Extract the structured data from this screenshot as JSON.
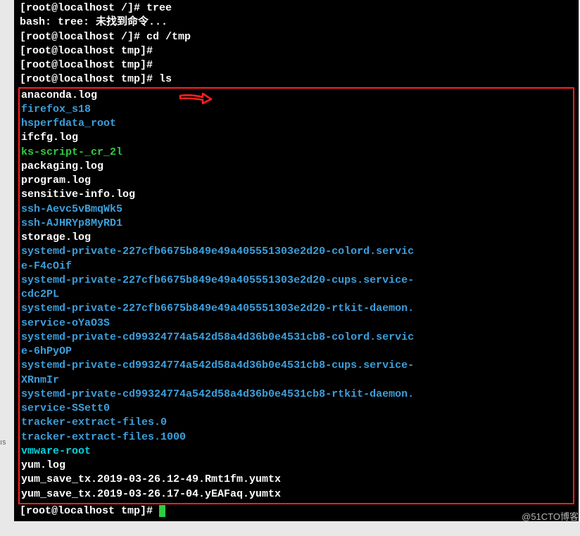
{
  "lines": [
    {
      "parts": [
        {
          "cls": "white",
          "t": "[root@localhost /]# tree"
        }
      ]
    },
    {
      "parts": [
        {
          "cls": "white",
          "t": "bash: tree: 未找到命令..."
        }
      ]
    },
    {
      "parts": [
        {
          "cls": "white",
          "t": "[root@localhost /]# cd /tmp"
        }
      ]
    },
    {
      "parts": [
        {
          "cls": "white",
          "t": "[root@localhost tmp]#"
        }
      ]
    },
    {
      "parts": [
        {
          "cls": "white",
          "t": "[root@localhost tmp]#"
        }
      ]
    },
    {
      "parts": [
        {
          "cls": "white",
          "t": "[root@localhost tmp]# ls"
        }
      ]
    }
  ],
  "box_lines": [
    {
      "parts": [
        {
          "cls": "white",
          "t": "anaconda.log"
        }
      ]
    },
    {
      "parts": [
        {
          "cls": "blue",
          "t": "firefox_s18"
        }
      ]
    },
    {
      "parts": [
        {
          "cls": "blue",
          "t": "hsperfdata_root"
        }
      ]
    },
    {
      "parts": [
        {
          "cls": "white",
          "t": "ifcfg.log"
        }
      ]
    },
    {
      "parts": [
        {
          "cls": "green",
          "t": "ks-script-_cr_2l"
        }
      ]
    },
    {
      "parts": [
        {
          "cls": "white",
          "t": "packaging.log"
        }
      ]
    },
    {
      "parts": [
        {
          "cls": "white",
          "t": "program.log"
        }
      ]
    },
    {
      "parts": [
        {
          "cls": "white",
          "t": "sensitive-info.log"
        }
      ]
    },
    {
      "parts": [
        {
          "cls": "blue",
          "t": "ssh-Aevc5vBmqWk5"
        }
      ]
    },
    {
      "parts": [
        {
          "cls": "blue",
          "t": "ssh-AJHRYp8MyRD1"
        }
      ]
    },
    {
      "parts": [
        {
          "cls": "white",
          "t": "storage.log"
        }
      ]
    },
    {
      "parts": [
        {
          "cls": "blue",
          "t": "systemd-private-227cfb6675b849e49a405551303e2d20-colord.servic"
        }
      ]
    },
    {
      "parts": [
        {
          "cls": "blue",
          "t": "e-F4cOif"
        }
      ]
    },
    {
      "parts": [
        {
          "cls": "blue",
          "t": "systemd-private-227cfb6675b849e49a405551303e2d20-cups.service-"
        }
      ]
    },
    {
      "parts": [
        {
          "cls": "blue",
          "t": "cdc2PL"
        }
      ]
    },
    {
      "parts": [
        {
          "cls": "blue",
          "t": "systemd-private-227cfb6675b849e49a405551303e2d20-rtkit-daemon."
        }
      ]
    },
    {
      "parts": [
        {
          "cls": "blue",
          "t": "service-oYaO3S"
        }
      ]
    },
    {
      "parts": [
        {
          "cls": "blue",
          "t": "systemd-private-cd99324774a542d58a4d36b0e4531cb8-colord.servic"
        }
      ]
    },
    {
      "parts": [
        {
          "cls": "blue",
          "t": "e-6hPyOP"
        }
      ]
    },
    {
      "parts": [
        {
          "cls": "blue",
          "t": "systemd-private-cd99324774a542d58a4d36b0e4531cb8-cups.service-"
        }
      ]
    },
    {
      "parts": [
        {
          "cls": "blue",
          "t": "XRnmIr"
        }
      ]
    },
    {
      "parts": [
        {
          "cls": "blue",
          "t": "systemd-private-cd99324774a542d58a4d36b0e4531cb8-rtkit-daemon."
        }
      ]
    },
    {
      "parts": [
        {
          "cls": "blue",
          "t": "service-SSett0"
        }
      ]
    },
    {
      "parts": [
        {
          "cls": "blue",
          "t": "tracker-extract-files.0"
        }
      ]
    },
    {
      "parts": [
        {
          "cls": "blue",
          "t": "tracker-extract-files.1000"
        }
      ]
    },
    {
      "parts": [
        {
          "cls": "cyan",
          "t": "vmware-root"
        }
      ]
    },
    {
      "parts": [
        {
          "cls": "white",
          "t": "yum.log"
        }
      ]
    },
    {
      "parts": [
        {
          "cls": "white",
          "t": "yum_save_tx.2019-03-26.12-49.Rmt1fm.yumtx"
        }
      ]
    },
    {
      "parts": [
        {
          "cls": "white",
          "t": "yum_save_tx.2019-03-26.17-04.yEAFaq.yumtx"
        }
      ]
    }
  ],
  "final_prompt": "[root@localhost tmp]# ",
  "watermark": "@51CTO博客",
  "side": "ıs"
}
